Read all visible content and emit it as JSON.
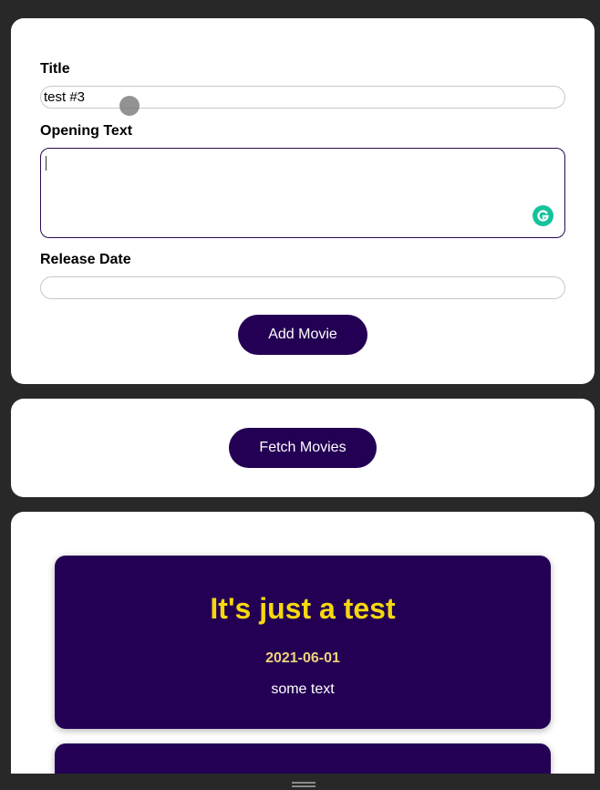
{
  "form": {
    "title_label": "Title",
    "title_value": "test #3",
    "opening_label": "Opening Text",
    "opening_value": "",
    "release_label": "Release Date",
    "release_value": "",
    "add_button": "Add Movie"
  },
  "fetch": {
    "button": "Fetch Movies"
  },
  "movies": [
    {
      "title": "It's just a test",
      "date": "2021-06-01",
      "text": "some text"
    }
  ],
  "icons": {
    "grammarly": "grammarly-icon"
  },
  "colors": {
    "accent": "#230054",
    "title_yellow": "#f5d80e",
    "date_gold": "#f0d27a",
    "grammarly_green": "#15c39a"
  }
}
